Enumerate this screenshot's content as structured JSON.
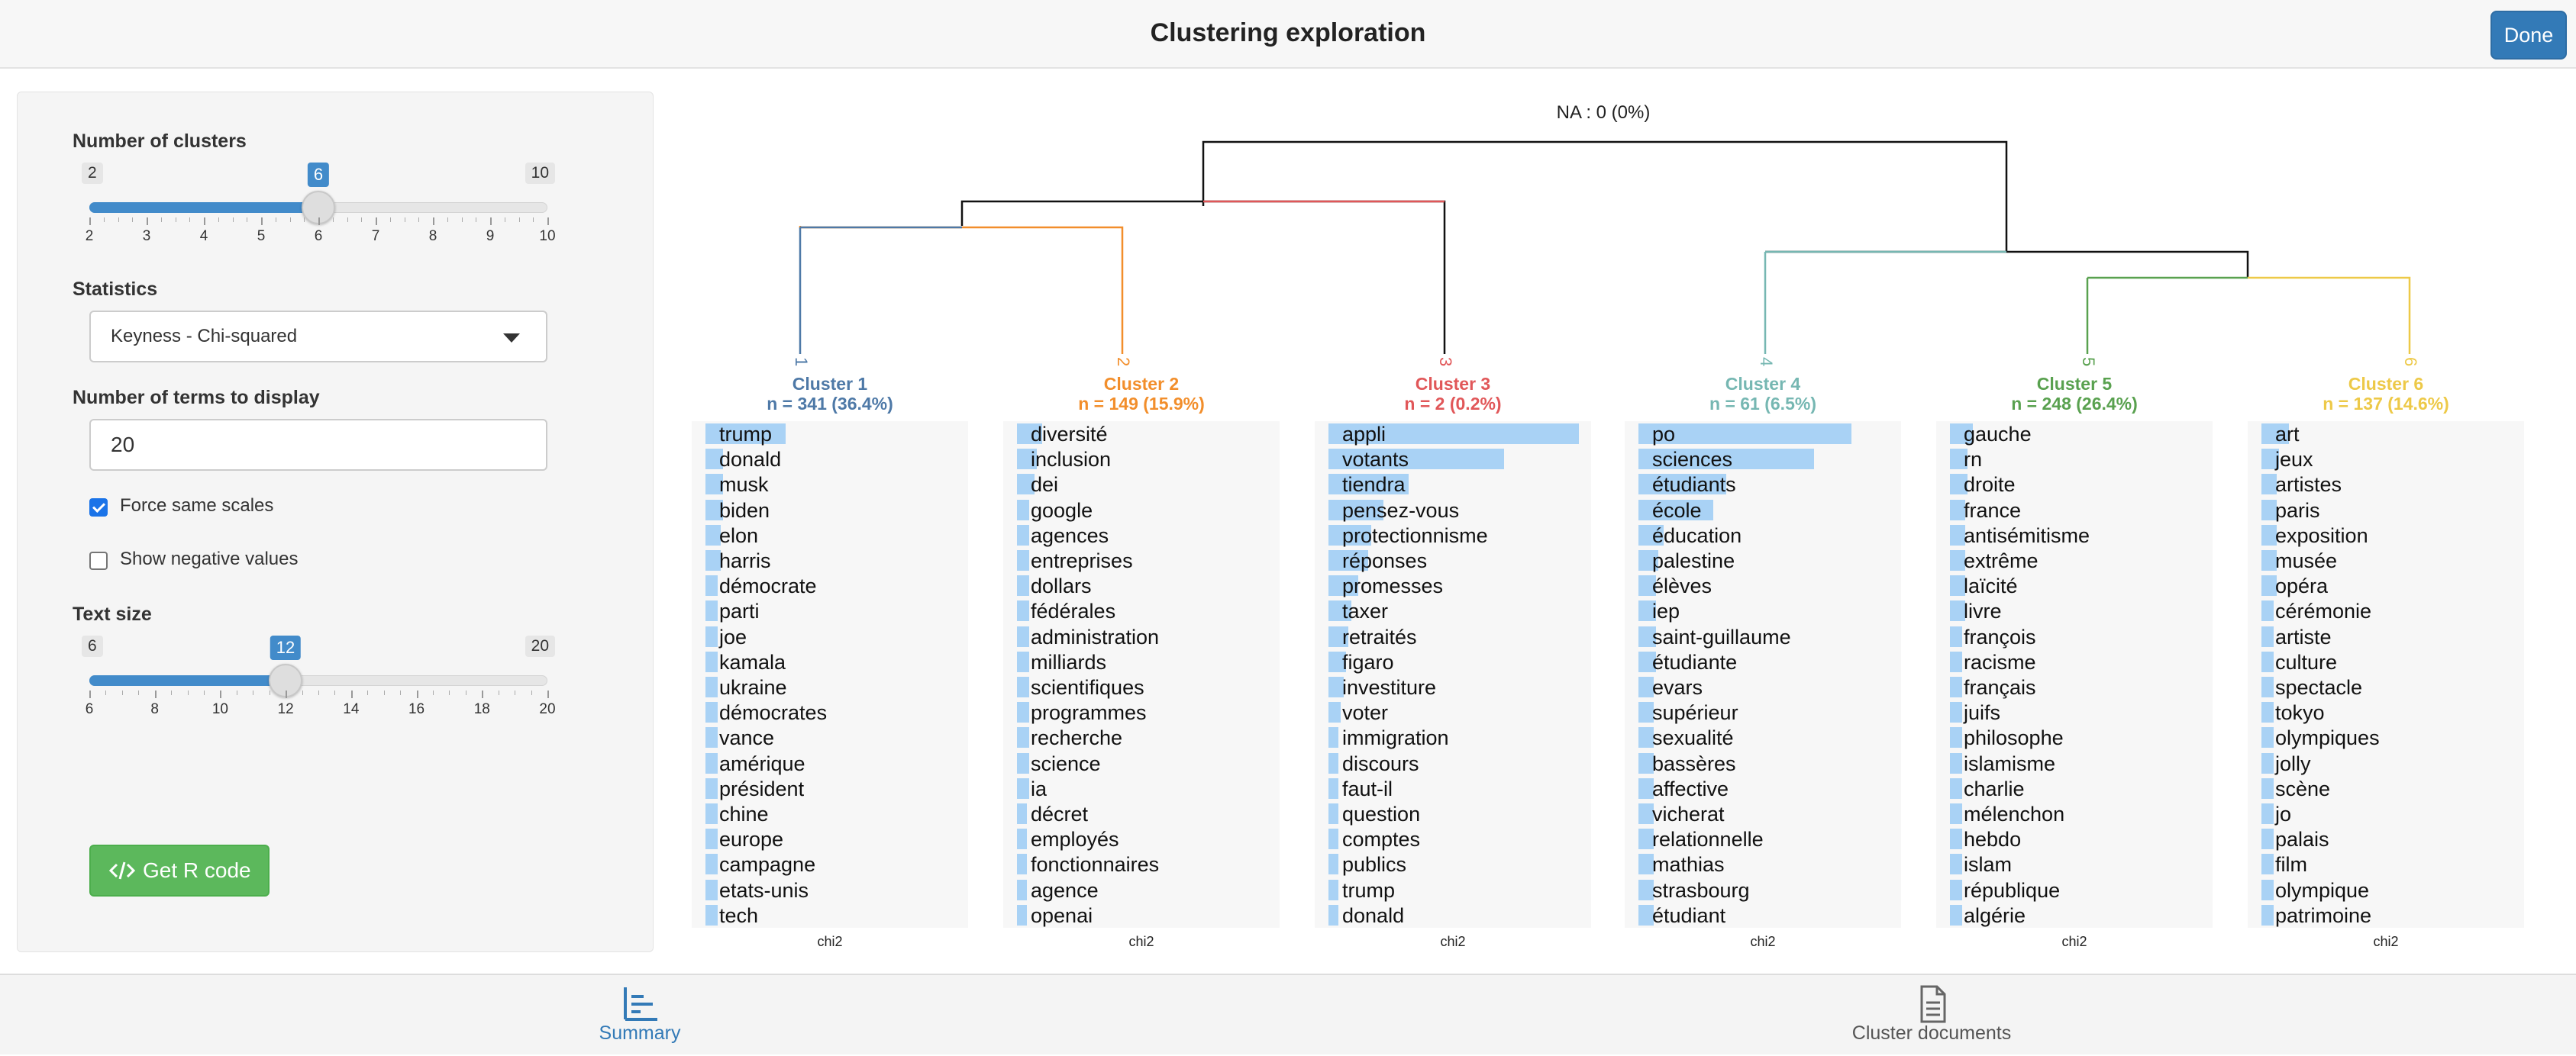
{
  "header": {
    "title": "Clustering exploration",
    "done_label": "Done"
  },
  "sidebar": {
    "clusters": {
      "label": "Number of clusters",
      "min": "2",
      "max": "10",
      "value": "6",
      "ticks": [
        "2",
        "3",
        "4",
        "5",
        "6",
        "7",
        "8",
        "9",
        "10"
      ]
    },
    "statistics": {
      "label": "Statistics",
      "selected": "Keyness - Chi-squared"
    },
    "terms": {
      "label": "Number of terms to display",
      "value": "20"
    },
    "force_same_scales": {
      "label": "Force same scales",
      "checked": true
    },
    "show_negative": {
      "label": "Show negative values",
      "checked": false
    },
    "text_size": {
      "label": "Text size",
      "min": "6",
      "max": "20",
      "value": "12",
      "ticks": [
        "6",
        "8",
        "10",
        "12",
        "14",
        "16",
        "18",
        "20"
      ]
    },
    "rcode_label": "Get R code"
  },
  "dendrogram": {
    "na_label": "NA : 0 (0%)",
    "leaf_labels": [
      "1",
      "2",
      "3",
      "4",
      "5",
      "6"
    ]
  },
  "colors": {
    "c1": "#4e79a7",
    "c2": "#f28e2b",
    "c3": "#e15759",
    "c4": "#76b7b2",
    "c5": "#59a14f",
    "c6": "#edc948",
    "bar": "#a9d2f5",
    "accent": "#428bca"
  },
  "clusters": [
    {
      "title": "Cluster 1",
      "count": "n = 341 (36.4%)",
      "axis": "chi2",
      "terms": [
        "trump",
        "donald",
        "musk",
        "biden",
        "elon",
        "harris",
        "démocrate",
        "parti",
        "joe",
        "kamala",
        "ukraine",
        "démocrates",
        "vance",
        "amérique",
        "président",
        "chine",
        "europe",
        "campagne",
        "etats-unis",
        "tech"
      ],
      "values": [
        0.32,
        0.07,
        0.07,
        0.07,
        0.06,
        0.06,
        0.05,
        0.05,
        0.05,
        0.05,
        0.05,
        0.05,
        0.05,
        0.05,
        0.05,
        0.05,
        0.05,
        0.05,
        0.05,
        0.05
      ]
    },
    {
      "title": "Cluster 2",
      "count": "n = 149 (15.9%)",
      "axis": "chi2",
      "terms": [
        "diversité",
        "inclusion",
        "dei",
        "google",
        "agences",
        "entreprises",
        "dollars",
        "fédérales",
        "administration",
        "milliards",
        "scientifiques",
        "programmes",
        "recherche",
        "science",
        "ia",
        "décret",
        "employés",
        "fonctionnaires",
        "agence",
        "openai"
      ],
      "values": [
        0.1,
        0.08,
        0.07,
        0.05,
        0.05,
        0.05,
        0.05,
        0.05,
        0.05,
        0.05,
        0.05,
        0.05,
        0.05,
        0.05,
        0.05,
        0.04,
        0.04,
        0.04,
        0.04,
        0.04
      ]
    },
    {
      "title": "Cluster 3",
      "count": "n = 2 (0.2%)",
      "axis": "chi2",
      "terms": [
        "appli",
        "votants",
        "tiendra",
        "pensez-vous",
        "protectionnisme",
        "réponses",
        "promesses",
        "taxer",
        "retraités",
        "figaro",
        "investiture",
        "voter",
        "immigration",
        "discours",
        "faut-il",
        "question",
        "comptes",
        "publics",
        "trump",
        "donald"
      ],
      "values": [
        1.0,
        0.7,
        0.32,
        0.22,
        0.17,
        0.16,
        0.12,
        0.09,
        0.08,
        0.07,
        0.06,
        0.05,
        0.04,
        0.04,
        0.04,
        0.04,
        0.04,
        0.04,
        0.04,
        0.04
      ]
    },
    {
      "title": "Cluster 4",
      "count": "n = 61 (6.5%)",
      "axis": "chi2",
      "terms": [
        "po",
        "sciences",
        "étudiants",
        "école",
        "éducation",
        "palestine",
        "élèves",
        "iep",
        "saint-guillaume",
        "étudiante",
        "evars",
        "supérieur",
        "sexualité",
        "bassères",
        "affective",
        "vicherat",
        "relationnelle",
        "mathias",
        "strasbourg",
        "étudiant"
      ],
      "values": [
        0.85,
        0.7,
        0.35,
        0.3,
        0.1,
        0.08,
        0.07,
        0.07,
        0.07,
        0.07,
        0.06,
        0.06,
        0.06,
        0.06,
        0.06,
        0.06,
        0.06,
        0.06,
        0.06,
        0.06
      ]
    },
    {
      "title": "Cluster 5",
      "count": "n = 248 (26.4%)",
      "axis": "chi2",
      "terms": [
        "gauche",
        "rn",
        "droite",
        "france",
        "antisémitisme",
        "extrême",
        "laïcité",
        "livre",
        "françois",
        "racisme",
        "français",
        "juifs",
        "philosophe",
        "islamisme",
        "charlie",
        "mélenchon",
        "hebdo",
        "islam",
        "république",
        "algérie"
      ],
      "values": [
        0.09,
        0.07,
        0.07,
        0.06,
        0.06,
        0.06,
        0.06,
        0.06,
        0.05,
        0.05,
        0.05,
        0.05,
        0.05,
        0.05,
        0.05,
        0.05,
        0.05,
        0.05,
        0.05,
        0.05
      ]
    },
    {
      "title": "Cluster 6",
      "count": "n = 137 (14.6%)",
      "axis": "chi2",
      "terms": [
        "art",
        "jeux",
        "artistes",
        "paris",
        "exposition",
        "musée",
        "opéra",
        "cérémonie",
        "artiste",
        "culture",
        "spectacle",
        "tokyo",
        "olympiques",
        "jolly",
        "scène",
        "jo",
        "palais",
        "film",
        "olympique",
        "patrimoine"
      ],
      "values": [
        0.11,
        0.07,
        0.06,
        0.06,
        0.06,
        0.06,
        0.06,
        0.05,
        0.05,
        0.05,
        0.05,
        0.05,
        0.05,
        0.05,
        0.05,
        0.05,
        0.05,
        0.05,
        0.05,
        0.05
      ]
    }
  ],
  "tabs": [
    {
      "label": "Summary",
      "icon": "bar-chart-icon",
      "active": true
    },
    {
      "label": "Cluster documents",
      "icon": "document-icon",
      "active": false
    }
  ]
}
